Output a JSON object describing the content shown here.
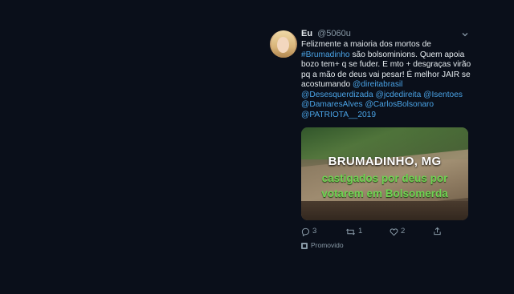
{
  "tweet": {
    "display_name": "Eu",
    "handle": "@5060u",
    "text_parts": [
      {
        "text": "Felizmente a maioria dos mortos de ",
        "link": false
      },
      {
        "text": "#Brumadinho",
        "link": true
      },
      {
        "text": " são bolsominions. Quem apoia bozo tem+ q se fuder. E mto + desgraças virão pq a mão de deus vai pesar! É melhor JAIR se acostumando ",
        "link": false
      },
      {
        "text": "@direitabrasil",
        "link": true
      },
      {
        "text": " ",
        "link": false
      },
      {
        "text": "@Desesquerdizada",
        "link": true
      },
      {
        "text": " ",
        "link": false
      },
      {
        "text": "@jcdedireita",
        "link": true
      },
      {
        "text": " ",
        "link": false
      },
      {
        "text": "@Isentoes",
        "link": true
      },
      {
        "text": " ",
        "link": false
      },
      {
        "text": "@DamaresAlves",
        "link": true
      },
      {
        "text": " ",
        "link": false
      },
      {
        "text": "@CarlosBolsonaro",
        "link": true
      },
      {
        "text": " ",
        "link": false
      },
      {
        "text": "@PATRIOTA__2019",
        "link": true
      }
    ],
    "media": {
      "caption_line1": "BRUMADINHO, MG",
      "caption_line2": "castigados por deus por votarem em Bolsomerda"
    },
    "actions": {
      "reply_icon": "reply-icon",
      "reply_count": "3",
      "retweet_icon": "retweet-icon",
      "retweet_count": "1",
      "like_icon": "heart-icon",
      "like_count": "2",
      "share_icon": "share-icon"
    },
    "promoted_label": "Promovido",
    "colors": {
      "background": "#0a0f1a",
      "link": "#4aa3e6",
      "text": "#e6ecf0",
      "muted": "#8899a6",
      "caption_green": "#6fd352"
    }
  }
}
